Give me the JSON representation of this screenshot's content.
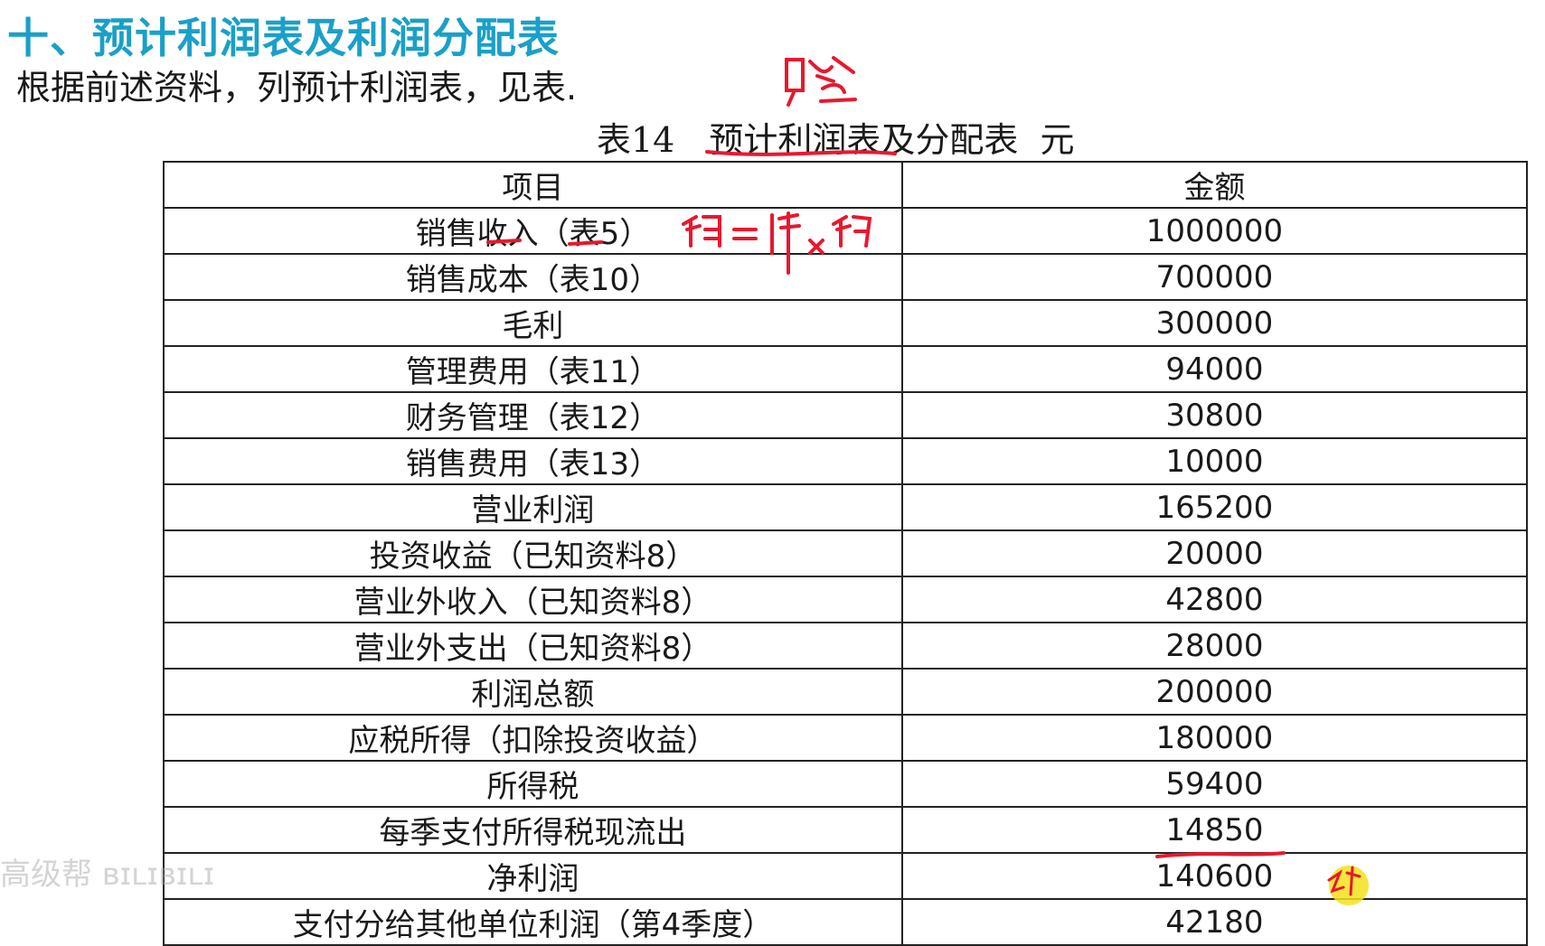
{
  "heading": "十、预计利润表及利润分配表",
  "intro": "根据前述资料，列预计利润表，见表.",
  "caption": {
    "number": "表14",
    "title": "预计利润表及分配表",
    "unit": "元"
  },
  "table": {
    "headers": [
      "项目",
      "金额"
    ],
    "rows": [
      {
        "item": "销售收入（表5）",
        "amount": "1000000"
      },
      {
        "item": "销售成本（表10）",
        "amount": "700000"
      },
      {
        "item": "毛利",
        "amount": "300000"
      },
      {
        "item": "管理费用（表11）",
        "amount": "94000"
      },
      {
        "item": "财务管理（表12）",
        "amount": "30800"
      },
      {
        "item": "销售费用（表13）",
        "amount": "10000"
      },
      {
        "item": "营业利润",
        "amount": "165200"
      },
      {
        "item": "投资收益（已知资料8）",
        "amount": "20000"
      },
      {
        "item": "营业外收入（已知资料8）",
        "amount": "42800"
      },
      {
        "item": "营业外支出（已知资料8）",
        "amount": "28000"
      },
      {
        "item": "利润总额",
        "amount": "200000"
      },
      {
        "item": "应税所得（扣除投资收益）",
        "amount": "180000"
      },
      {
        "item": "所得税",
        "amount": "59400"
      },
      {
        "item": "每季支付所得税现流出",
        "amount": "14850"
      },
      {
        "item": "净利润",
        "amount": "140600"
      },
      {
        "item": "支付分给其他单位利润（第4季度）",
        "amount": "42180"
      }
    ]
  },
  "annotation_color": "#e8182e",
  "cursor_color": "#f2e21a"
}
